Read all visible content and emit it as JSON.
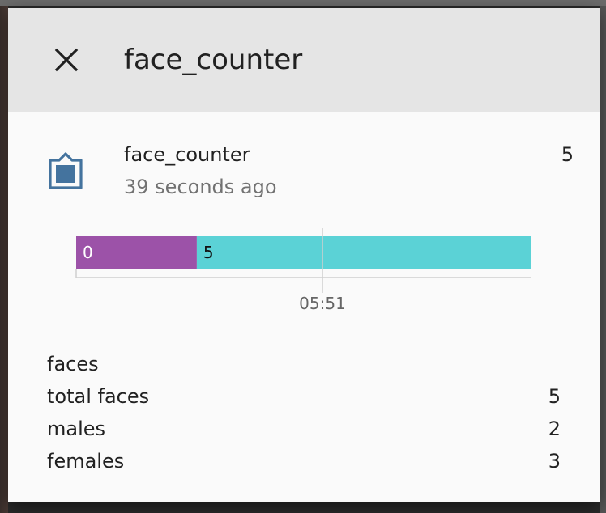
{
  "dialog": {
    "title": "face_counter",
    "close_icon": "close-icon"
  },
  "entity": {
    "icon": "clipboard-account-icon",
    "name": "face_counter",
    "last_changed": "39 seconds ago",
    "state": "5"
  },
  "history": {
    "segments": [
      {
        "label": "0",
        "color": "#9c52a8",
        "fraction": 0.265
      },
      {
        "label": "5",
        "color": "#5bd2d6",
        "fraction": 0.735
      }
    ],
    "tick_label": "05:51"
  },
  "attributes": {
    "heading": "faces",
    "rows": [
      {
        "name": "total faces",
        "value": "5"
      },
      {
        "name": "males",
        "value": "2"
      },
      {
        "name": "females",
        "value": "3"
      }
    ]
  },
  "colors": {
    "header_bg": "#e5e5e5",
    "dialog_bg": "#fafafa",
    "icon": "#44739e"
  }
}
